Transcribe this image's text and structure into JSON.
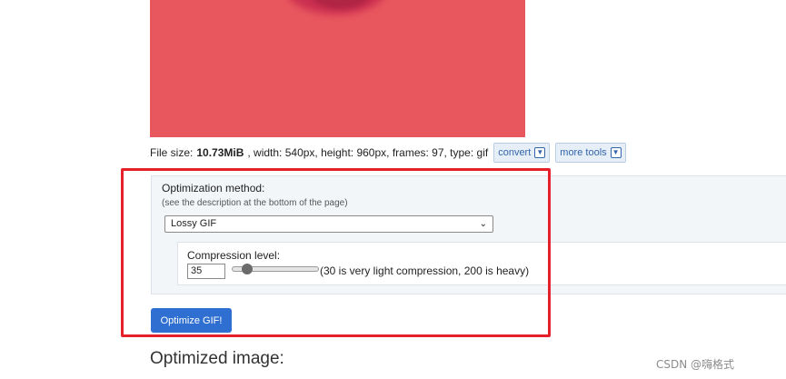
{
  "file_info": {
    "size_label": "File size: ",
    "size_value": "10.73MiB",
    "details": ", width: 540px, height: 960px, frames: 97, type: gif",
    "convert_label": "convert",
    "more_tools_label": "more tools"
  },
  "optimization": {
    "method_label": "Optimization method:",
    "method_hint": "(see the description at the bottom of the page)",
    "method_selected": "Lossy GIF",
    "compression_label": "Compression level:",
    "compression_value": "35",
    "compression_fraction": 0.17,
    "compression_hint": "(30 is very light compression, 200 is heavy)",
    "submit_label": "Optimize GIF!"
  },
  "result": {
    "title": "Optimized image:"
  },
  "watermark": "CSDN @嗨格式",
  "colors": {
    "preview_bg": "#e8575e",
    "button_bg": "#2f6fd1",
    "highlight": "#e5202a"
  }
}
